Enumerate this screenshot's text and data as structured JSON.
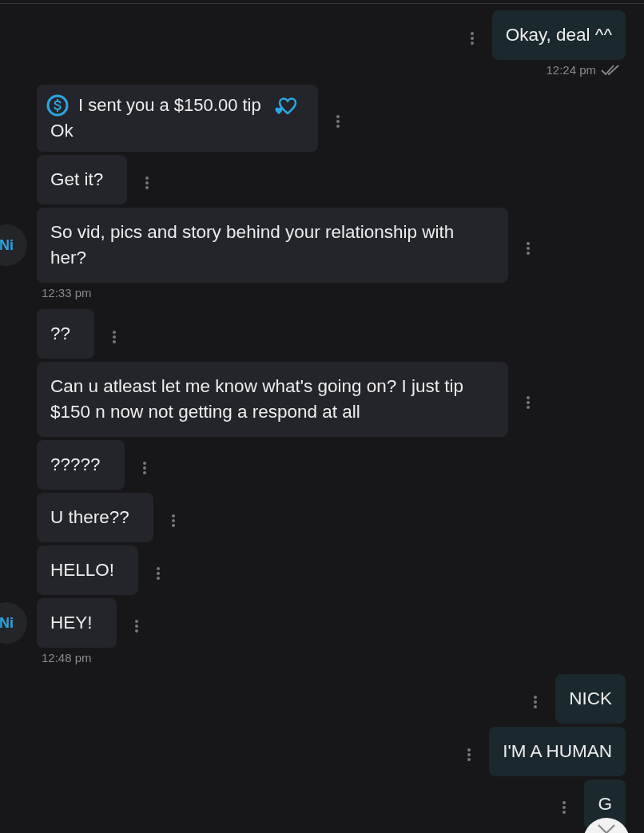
{
  "messages": [
    {
      "kind": "outgoing",
      "text": "Okay, deal ^^",
      "time": "12:24 pm",
      "read": true
    },
    {
      "kind": "incoming",
      "tip": "I sent you a $150.00 tip",
      "text": "Ok",
      "avatar": false
    },
    {
      "kind": "incoming",
      "text": "Get it?",
      "avatar": false
    },
    {
      "kind": "incoming",
      "text": "So vid, pics and story behind your relationship with her?",
      "avatar": true,
      "avatar_label": "Ni",
      "time": "12:33 pm"
    },
    {
      "kind": "incoming",
      "text": "??",
      "avatar": false
    },
    {
      "kind": "incoming",
      "text": "Can u atleast let me know what's going on? I just tip $150 n now not getting a respond at all",
      "avatar": false
    },
    {
      "kind": "incoming",
      "text": "?????",
      "avatar": false
    },
    {
      "kind": "incoming",
      "text": "U there??",
      "avatar": false
    },
    {
      "kind": "incoming",
      "text": "HELLO!",
      "avatar": false
    },
    {
      "kind": "incoming",
      "text": "HEY!",
      "avatar": true,
      "avatar_label": "Ni",
      "time": "12:48 pm"
    },
    {
      "kind": "outgoing",
      "text": "NICK"
    },
    {
      "kind": "outgoing",
      "text": "I'M A HUMAN"
    },
    {
      "kind": "outgoing",
      "text": "G"
    }
  ]
}
